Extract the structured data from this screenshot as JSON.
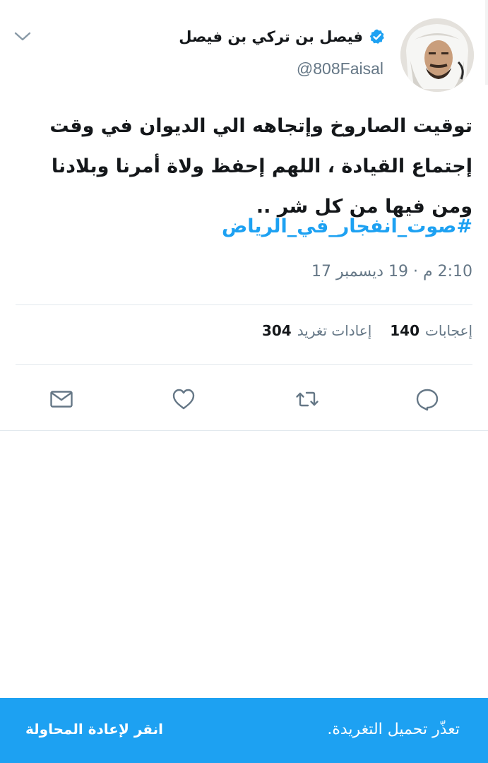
{
  "tweet": {
    "author": {
      "display_name": "فيصل بن تركي بن فيصل",
      "handle": "@808Faisal",
      "verified": true
    },
    "text": "توقيت الصاروخ وإتجاهه الي الديوان في وقت إجتماع القيادة ، اللهم إحفظ ولاة أمرنا وبلادنا ومن فيها من كل شر ..",
    "hashtag": "#صوت_انفجار_في_الرياض",
    "timestamp": "2:10 م · 19 ديسمبر 17",
    "stats": {
      "retweets_count": "304",
      "retweets_label": "إعادات تغريد",
      "likes_count": "140",
      "likes_label": "إعجابات"
    },
    "actions": {
      "reply_icon": "reply-icon",
      "retweet_icon": "retweet-icon",
      "like_icon": "heart-icon",
      "dm_icon": "envelope-icon"
    }
  },
  "banner": {
    "message": "تعذّر تحميل التغريدة.",
    "retry_label": "انقر لإعادة المحاولة"
  },
  "colors": {
    "accent": "#1da1f2",
    "text_primary": "#14171a",
    "text_secondary": "#657786",
    "divider": "#e1e8ed"
  }
}
